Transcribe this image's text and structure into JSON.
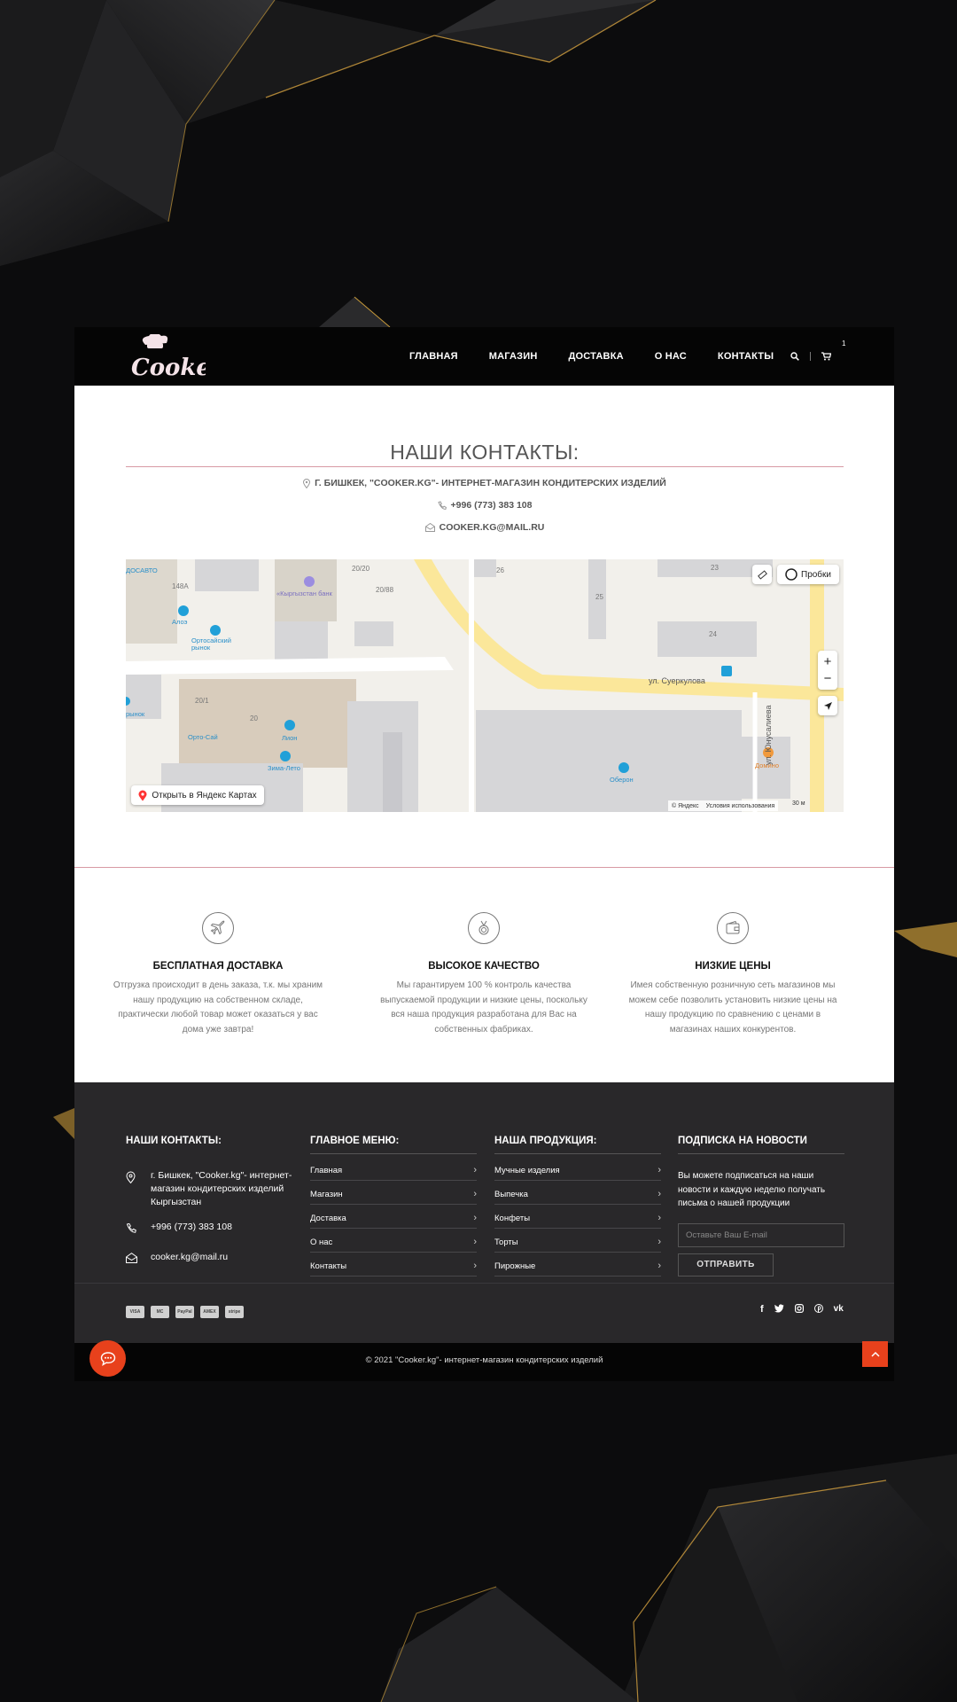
{
  "nav": {
    "logo_text": "Cooker",
    "items": [
      "ГЛАВНАЯ",
      "МАГАЗИН",
      "ДОСТАВКА",
      "О НАС",
      "КОНТАКТЫ"
    ],
    "cart_count": "1"
  },
  "contacts": {
    "title": "НАШИ КОНТАКТЫ:",
    "address": "Г. БИШКЕК, \"COOKER.KG\"- ИНТЕРНЕТ-МАГАЗИН КОНДИТЕРСКИХ ИЗДЕЛИЙ",
    "phone": "+996 (773) 383 108",
    "email": "COOKER.KG@MAIL.RU"
  },
  "map": {
    "traffic_button": "Пробки",
    "open_button": "Открыть в Яндекс Картах",
    "street_1": "ул. Суеркулова",
    "street_2": "ул. Юнусалиева",
    "poi": [
      "Алоэ",
      "Ортосайский рынок",
      "Орто-Сай",
      "Лион",
      "Зима-Лето",
      "Оберон",
      "Домино",
      "«Кыргызстан банк",
      "ДОСАВТО",
      "рынок"
    ],
    "buildings": [
      "148А",
      "20/20",
      "20/88",
      "26",
      "23",
      "25",
      "24",
      "20/1",
      "20"
    ],
    "copyright": "© Яндекс",
    "terms": "Условия использования",
    "scale": "30 м"
  },
  "features": [
    {
      "title": "БЕСПЛАТНАЯ ДОСТАВКА",
      "text": "Отгрузка происходит в день заказа, т.к. мы храним нашу продукцию на собственном складе, практически любой товар может оказаться у вас дома уже завтра!",
      "icon": "airplane-icon"
    },
    {
      "title": "ВЫСОКОЕ КАЧЕСТВО",
      "text": "Мы гарантируем 100 % контроль качества выпускаемой продукции и низкие цены, поскольку вся наша продукция разработана для Вас на собственных фабриках.",
      "icon": "medal-icon"
    },
    {
      "title": "НИЗКИЕ ЦЕНЫ",
      "text": "Имея собственную розничную сеть магазинов мы можем себе позволить установить низкие цены на нашу продукцию по сравнению с ценами в магазинах наших конкурентов.",
      "icon": "wallet-icon"
    }
  ],
  "footer": {
    "contacts_title": "НАШИ КОНТАКТЫ:",
    "address": "г. Бишкек, \"Cooker.kg\"- интернет-магазин кондитерских изделий Кыргызстан",
    "phone": "+996 (773) 383 108",
    "email": "cooker.kg@mail.ru",
    "menu_title": "ГЛАВНОЕ МЕНЮ:",
    "menu": [
      "Главная",
      "Магазин",
      "Доставка",
      "О нас",
      "Контакты"
    ],
    "products_title": "НАША ПРОДУКЦИЯ:",
    "products": [
      "Мучные изделия",
      "Выпечка",
      "Конфеты",
      "Торты",
      "Пирожные"
    ],
    "news_title": "ПОДПИСКА НА НОВОСТИ",
    "news_text": "Вы можете подписаться на наши новости и каждую неделю получать письма о нашей продукции",
    "email_placeholder": "Оставьте Ваш E-mail",
    "submit": "ОТПРАВИТЬ",
    "payments": [
      "VISA",
      "MC",
      "PayPal",
      "AMEX",
      "stripe"
    ],
    "copyright": "© 2021 \"Cooker.kg\"- интернет-магазин кондитерских изделий"
  },
  "colors": {
    "accent": "#e8411c",
    "divider": "#d89aa4",
    "footer_bg": "#29282a"
  }
}
